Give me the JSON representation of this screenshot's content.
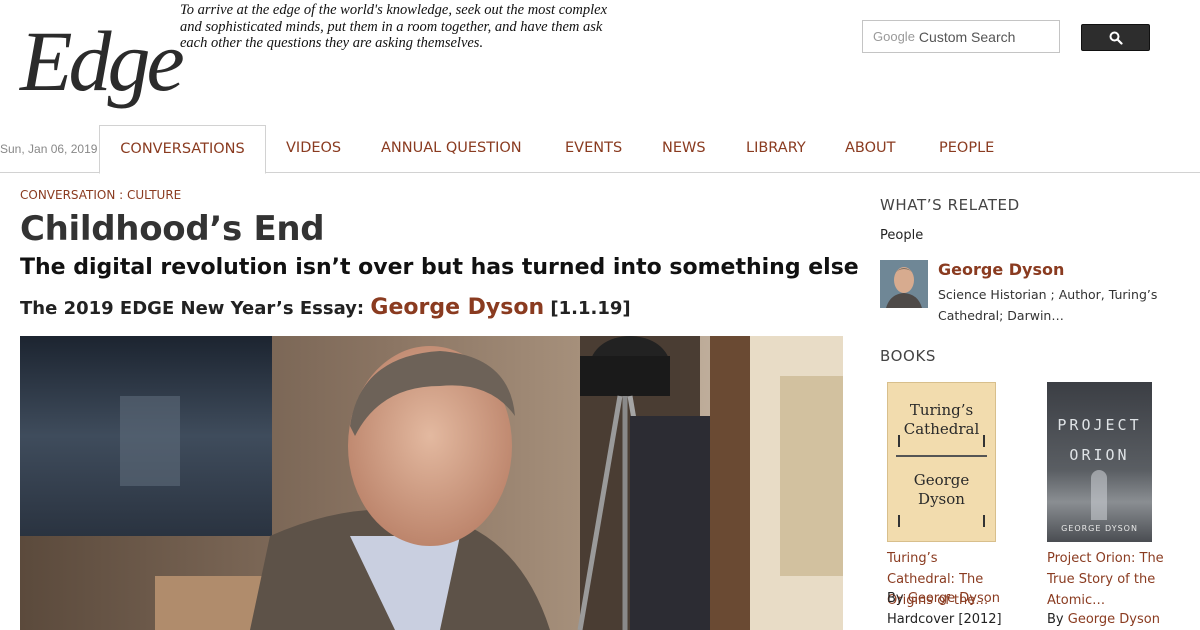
{
  "header": {
    "logo_text": "Edge",
    "tagline": "To arrive at the edge of the world's knowledge, seek out the most complex and sophisticated minds, put them in a room together, and have them ask each other the questions they are asking themselves.",
    "search": {
      "brand": "Google",
      "placeholder": "Custom Search",
      "button_icon": "search-icon"
    }
  },
  "nav": {
    "date": "Sun, Jan 06, 2019",
    "tabs": [
      {
        "label": "CONVERSATIONS",
        "active": true
      },
      {
        "label": "VIDEOS"
      },
      {
        "label": "ANNUAL QUESTION"
      },
      {
        "label": "EVENTS"
      },
      {
        "label": "NEWS"
      },
      {
        "label": "LIBRARY"
      },
      {
        "label": "ABOUT"
      },
      {
        "label": "PEOPLE"
      }
    ]
  },
  "article": {
    "breadcrumb": "CONVERSATION : CULTURE",
    "title": "Childhood’s End",
    "subtitle": "The digital revolution isn’t over but has turned into something else",
    "essay_prefix": "The 2019 EDGE New Year’s Essay: ",
    "author": "George Dyson",
    "essay_date": "[1.1.19]"
  },
  "sidebar": {
    "related_heading": "WHAT’S RELATED",
    "people_label": "People",
    "person": {
      "name": "George Dyson",
      "description": "Science Historian ; Author, Turing’s Cathedral; Darwin…"
    },
    "books_heading": "BOOKS",
    "books": [
      {
        "cover_lines": [
          "Turing’s",
          "Cathedral",
          "George",
          "Dyson"
        ],
        "title": "Turing’s Cathedral: The Origins of the…",
        "by": "By ",
        "author": "George Dyson",
        "format": "Hardcover [2012]"
      },
      {
        "cover_lines": [
          "PROJECT",
          "ORION",
          "GEORGE DYSON"
        ],
        "title": "Project Orion: The True Story of the Atomic…",
        "by": "By ",
        "author": "George Dyson"
      }
    ]
  },
  "colors": {
    "accent": "#8a3b20",
    "text": "#222222",
    "border": "#d2d2d2"
  }
}
